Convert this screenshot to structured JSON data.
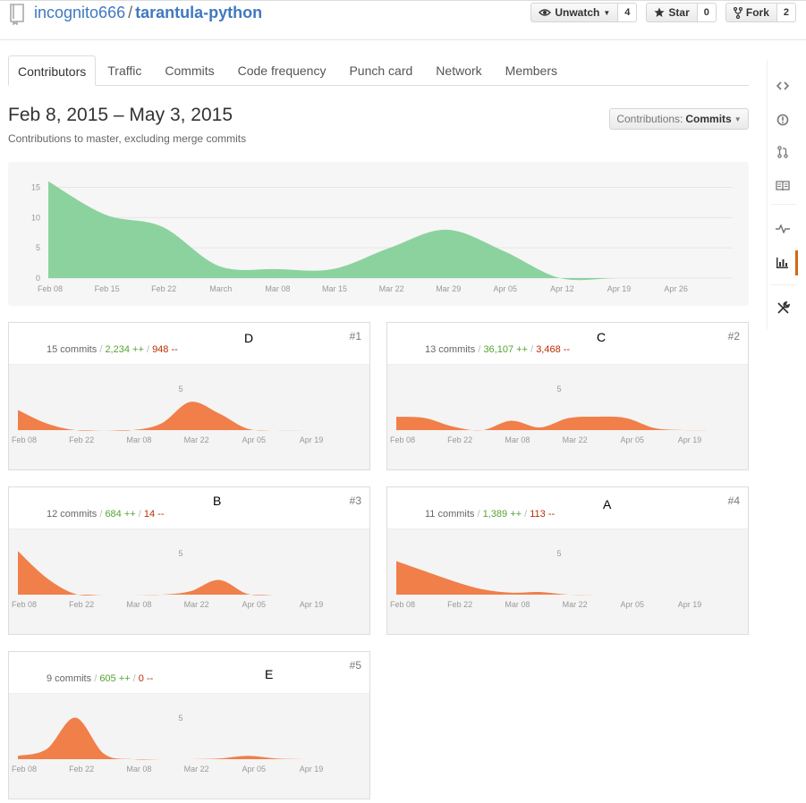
{
  "repo": {
    "owner": "incognito666",
    "separator": "/",
    "name": "tarantula-python"
  },
  "header_actions": [
    {
      "key": "unwatch",
      "label": "Unwatch",
      "count": "4",
      "icon": "eye-icon"
    },
    {
      "key": "star",
      "label": "Star",
      "count": "0",
      "icon": "star-icon"
    },
    {
      "key": "fork",
      "label": "Fork",
      "count": "2",
      "icon": "fork-icon"
    }
  ],
  "tabs": [
    {
      "label": "Contributors",
      "active": true
    },
    {
      "label": "Traffic"
    },
    {
      "label": "Commits"
    },
    {
      "label": "Code frequency"
    },
    {
      "label": "Punch card"
    },
    {
      "label": "Network"
    },
    {
      "label": "Members"
    }
  ],
  "rail": [
    "code-icon",
    "issue-icon",
    "pull-request-icon",
    "wiki-icon",
    "pulse-icon",
    "graphs-icon",
    "settings-icon"
  ],
  "range": {
    "title": "Feb 8, 2015 – May 3, 2015",
    "subtitle": "Contributions to master, excluding merge commits",
    "select_prefix": "Contributions:",
    "select_value": "Commits"
  },
  "colors": {
    "main_fill": "#8cd29f",
    "contrib_fill": "#f17f49",
    "link": "#4078c0",
    "active_rail": "#d26911"
  },
  "chart_data": [
    {
      "type": "area",
      "title": "",
      "x": [
        "Feb 08",
        "Feb 15",
        "Feb 22",
        "March",
        "Mar 08",
        "Mar 15",
        "Mar 22",
        "Mar 29",
        "Apr 05",
        "Apr 12",
        "Apr 19",
        "Apr 26"
      ],
      "values": [
        16,
        10.5,
        8.5,
        2,
        1.5,
        1.5,
        5,
        8,
        4.5,
        0,
        0,
        0
      ],
      "yticks": [
        0,
        5,
        10,
        15
      ],
      "ylim": [
        0,
        17
      ]
    },
    {
      "type": "area",
      "title": "15 commits",
      "rank": "#1",
      "letter": "D",
      "additions": "2,234 ++",
      "deletions": "948 --",
      "x": [
        "Feb 08",
        "Feb 15",
        "Feb 22",
        "March",
        "Mar 08",
        "Mar 15",
        "Mar 22",
        "Mar 29",
        "Apr 05",
        "Apr 12",
        "Apr 19",
        "Apr 26"
      ],
      "values": [
        3,
        1,
        0,
        0,
        0,
        1,
        4.2,
        2.5,
        0.2,
        0,
        0,
        0
      ],
      "xticks": [
        "Feb 08",
        "Feb 22",
        "Mar 08",
        "Mar 22",
        "Apr 05",
        "Apr 19"
      ],
      "ytick": "5"
    },
    {
      "type": "area",
      "title": "13 commits",
      "rank": "#2",
      "letter": "C",
      "additions": "36,107 ++",
      "deletions": "3,468 --",
      "x": [
        "Feb 08",
        "Feb 15",
        "Feb 22",
        "March",
        "Mar 08",
        "Mar 15",
        "Mar 22",
        "Mar 29",
        "Apr 05",
        "Apr 12",
        "Apr 19",
        "Apr 26"
      ],
      "values": [
        2,
        1.8,
        0.5,
        0,
        1.4,
        0.4,
        1.8,
        2,
        1.8,
        0.3,
        0,
        0
      ],
      "xticks": [
        "Feb 08",
        "Feb 22",
        "Mar 08",
        "Mar 22",
        "Apr 05",
        "Apr 19"
      ],
      "ytick": "5"
    },
    {
      "type": "area",
      "title": "12 commits",
      "rank": "#3",
      "letter": "B",
      "additions": "684 ++",
      "deletions": "14 --",
      "x": [
        "Feb 08",
        "Feb 15",
        "Feb 22",
        "March",
        "Mar 08",
        "Mar 15",
        "Mar 22",
        "Mar 29",
        "Apr 05",
        "Apr 12",
        "Apr 19",
        "Apr 26"
      ],
      "values": [
        6.5,
        2.5,
        0.1,
        0,
        0,
        0,
        0.5,
        2.2,
        0.1,
        0,
        0,
        0
      ],
      "xticks": [
        "Feb 08",
        "Feb 22",
        "Mar 08",
        "Mar 22",
        "Apr 05",
        "Apr 19"
      ],
      "ytick": "5"
    },
    {
      "type": "area",
      "title": "11 commits",
      "rank": "#4",
      "letter": "A",
      "additions": "1,389 ++",
      "deletions": "113 --",
      "x": [
        "Feb 08",
        "Feb 15",
        "Feb 22",
        "March",
        "Mar 08",
        "Mar 15",
        "Mar 22",
        "Mar 29",
        "Apr 05",
        "Apr 12",
        "Apr 19",
        "Apr 26"
      ],
      "values": [
        5,
        3.5,
        2,
        0.8,
        0.3,
        0.4,
        0,
        0,
        0,
        0,
        0,
        0
      ],
      "xticks": [
        "Feb 08",
        "Feb 22",
        "Mar 08",
        "Mar 22",
        "Apr 05",
        "Apr 19"
      ],
      "ytick": "5"
    },
    {
      "type": "area",
      "title": "9 commits",
      "rank": "#5",
      "letter": "E",
      "additions": "605 ++",
      "deletions": "0 --",
      "x": [
        "Feb 08",
        "Feb 15",
        "Feb 22",
        "March",
        "Mar 08",
        "Mar 15",
        "Mar 22",
        "Mar 29",
        "Apr 05",
        "Apr 12",
        "Apr 19",
        "Apr 26"
      ],
      "values": [
        0.5,
        1.5,
        6.2,
        0.8,
        0,
        0,
        0,
        0.1,
        0.5,
        0.1,
        0,
        0
      ],
      "xticks": [
        "Feb 08",
        "Feb 22",
        "Mar 08",
        "Mar 22",
        "Apr 05",
        "Apr 19"
      ],
      "ytick": "5"
    }
  ]
}
